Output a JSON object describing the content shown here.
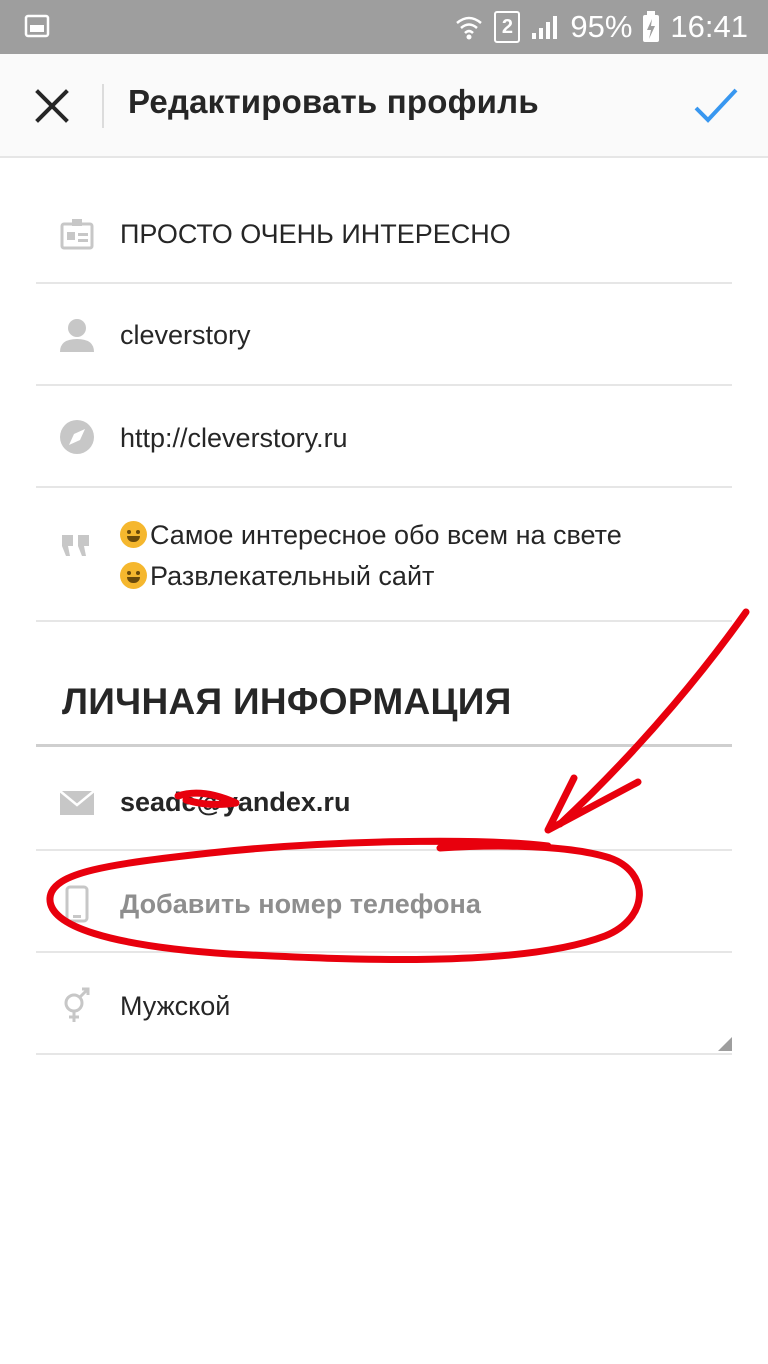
{
  "status_bar": {
    "sim_number": "2",
    "battery": "95%",
    "time": "16:41"
  },
  "header": {
    "title": "Редактировать профиль"
  },
  "profile": {
    "name": "ПРОСТО ОЧЕНЬ ИНТЕРЕСНО",
    "username": "cleverstory",
    "website": "http://cleverstory.ru",
    "bio_line_1": "Самое интересное обо всем на свете",
    "bio_line_2": "Развлекательный сайт"
  },
  "private_info": {
    "section_title": "ЛИЧНАЯ ИНФОРМАЦИЯ",
    "email": "seade@yandex.ru",
    "phone_placeholder": "Добавить номер телефона",
    "gender": "Мужской"
  },
  "colors": {
    "accent": "#3897f0",
    "annotation": "#e8000d",
    "status_bar": "#9e9e9e",
    "icon_gray": "#c7c7c7"
  }
}
